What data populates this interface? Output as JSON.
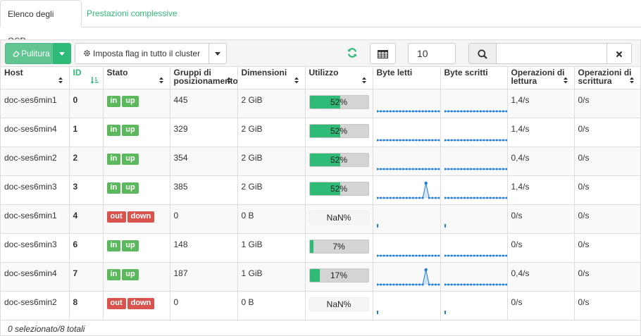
{
  "tabs": [
    {
      "label": "Elenco degli OSD",
      "active": true
    },
    {
      "label": "Prestazioni complessive",
      "active": false
    }
  ],
  "toolbar": {
    "scrub_label": "Pulitura",
    "flags_label": "Imposta flag in tutto il cluster",
    "page_size": "10",
    "search_value": ""
  },
  "columns": [
    {
      "label": "Host"
    },
    {
      "label": "ID"
    },
    {
      "label": "Stato"
    },
    {
      "label": "Gruppi di posizionamento"
    },
    {
      "label": "Dimensioni"
    },
    {
      "label": "Utilizzo"
    },
    {
      "label": "Byte letti"
    },
    {
      "label": "Byte scritti"
    },
    {
      "label": "Operazioni di lettura"
    },
    {
      "label": "Operazioni di scrittura"
    }
  ],
  "rows": [
    {
      "host": "doc-ses6min1",
      "id": "0",
      "status": [
        "in",
        "up"
      ],
      "pgs": "445",
      "size": "2 GiB",
      "usage_text": "52%",
      "usage": 0.52,
      "read_bytes": [
        0,
        0,
        0,
        0,
        0,
        0,
        0,
        0,
        0,
        0,
        0,
        0,
        0,
        0,
        0,
        0,
        0,
        0,
        0,
        0
      ],
      "write_bytes": [
        0,
        0,
        0,
        0,
        0,
        0,
        0,
        0,
        0,
        0,
        0,
        0,
        0,
        0,
        0,
        0,
        0,
        0,
        0,
        0
      ],
      "read_ops": "1,4/s",
      "write_ops": "0/s"
    },
    {
      "host": "doc-ses6min4",
      "id": "1",
      "status": [
        "in",
        "up"
      ],
      "pgs": "329",
      "size": "2 GiB",
      "usage_text": "52%",
      "usage": 0.52,
      "read_bytes": [
        0,
        0,
        0,
        0,
        0,
        0,
        0,
        0,
        0,
        0,
        0,
        0,
        0,
        0,
        0,
        0,
        0,
        0,
        0,
        0
      ],
      "write_bytes": [
        0,
        0,
        0,
        0,
        0,
        0,
        0,
        0,
        0,
        0,
        0,
        0,
        0,
        0,
        0,
        0,
        0,
        0,
        0,
        0
      ],
      "read_ops": "1,4/s",
      "write_ops": "0/s"
    },
    {
      "host": "doc-ses6min2",
      "id": "2",
      "status": [
        "in",
        "up"
      ],
      "pgs": "354",
      "size": "2 GiB",
      "usage_text": "52%",
      "usage": 0.52,
      "read_bytes": [
        0,
        0,
        0,
        0,
        0,
        0,
        0,
        0,
        0,
        0,
        0,
        0,
        0,
        0,
        0,
        0,
        0,
        0,
        0,
        0
      ],
      "write_bytes": [
        0,
        0,
        0,
        0,
        0,
        0,
        0,
        0,
        0,
        0,
        0,
        0,
        0,
        0,
        0,
        0,
        0,
        0,
        0,
        0
      ],
      "read_ops": "0,4/s",
      "write_ops": "0/s"
    },
    {
      "host": "doc-ses6min3",
      "id": "3",
      "status": [
        "in",
        "up"
      ],
      "pgs": "385",
      "size": "2 GiB",
      "usage_text": "52%",
      "usage": 0.52,
      "read_bytes": [
        0,
        0,
        0,
        0,
        0,
        0,
        0,
        0,
        0,
        0,
        0,
        0,
        0,
        0,
        0,
        1,
        0,
        0,
        0,
        0
      ],
      "write_bytes": [
        0,
        0,
        0,
        0,
        0,
        0,
        0,
        0,
        0,
        0,
        0,
        0,
        0,
        0,
        0,
        0,
        0,
        0,
        0,
        0
      ],
      "read_ops": "1,4/s",
      "write_ops": "0/s"
    },
    {
      "host": "doc-ses6min1",
      "id": "4",
      "status": [
        "out",
        "down"
      ],
      "pgs": "0",
      "size": "0 B",
      "usage_text": "NaN%",
      "usage": 0,
      "read_bytes": [
        0
      ],
      "write_bytes": [
        0
      ],
      "read_ops": "0/s",
      "write_ops": "0/s"
    },
    {
      "host": "doc-ses6min3",
      "id": "6",
      "status": [
        "in",
        "up"
      ],
      "pgs": "148",
      "size": "1 GiB",
      "usage_text": "7%",
      "usage": 0.07,
      "read_bytes": [
        0,
        0,
        0,
        0,
        0,
        0,
        0,
        0,
        0,
        0,
        0,
        0,
        0,
        0,
        0,
        0,
        0,
        0,
        0,
        0
      ],
      "write_bytes": [
        0,
        0,
        0,
        0,
        0,
        0,
        0,
        0,
        0,
        0,
        0,
        0,
        0,
        0,
        0,
        0,
        0,
        0,
        0,
        0
      ],
      "read_ops": "0/s",
      "write_ops": "0/s"
    },
    {
      "host": "doc-ses6min4",
      "id": "7",
      "status": [
        "in",
        "up"
      ],
      "pgs": "187",
      "size": "1 GiB",
      "usage_text": "17%",
      "usage": 0.17,
      "read_bytes": [
        0,
        0,
        0,
        0,
        0,
        0,
        0,
        0,
        0,
        0,
        0,
        0,
        0,
        0,
        0,
        1,
        0,
        0,
        0,
        0
      ],
      "write_bytes": [
        0,
        0,
        0,
        0,
        0,
        0,
        0,
        0,
        0,
        0,
        0,
        0,
        0,
        0,
        0,
        0,
        0,
        0,
        0,
        0
      ],
      "read_ops": "0,4/s",
      "write_ops": "0/s"
    },
    {
      "host": "doc-ses6min2",
      "id": "8",
      "status": [
        "out",
        "down"
      ],
      "pgs": "0",
      "size": "0 B",
      "usage_text": "NaN%",
      "usage": 0,
      "read_bytes": [
        0
      ],
      "write_bytes": [
        0
      ],
      "read_ops": "0/s",
      "write_ops": "0/s"
    }
  ],
  "footer": "0 selezionato/8 totali",
  "colors": {
    "accent": "#30ba78",
    "spark": "#1f7ed6",
    "label_green": "#5cb85c",
    "label_red": "#d9534f"
  }
}
